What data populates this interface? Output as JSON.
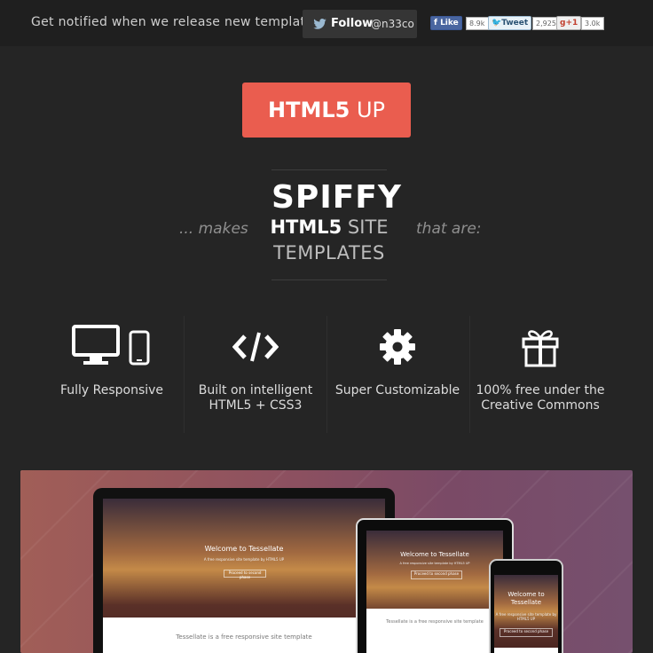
{
  "topbar": {
    "notify_text": "Get notified when we release new templates!",
    "follow_label": "Follow",
    "follow_handle": "@n33co",
    "like_label": "Like",
    "like_count": "8.9k",
    "tweet_label": "Tweet",
    "tweet_count": "2,925",
    "plusone_label": "+1",
    "plusone_count": "3.0k"
  },
  "logo": {
    "bold": "HTML5",
    "light": " UP"
  },
  "tagline": {
    "lead": "... makes",
    "title": "SPIFFY",
    "line2_bold": "HTML5",
    "line2_rest": " SITE",
    "line3": "TEMPLATES",
    "tail": "that are:"
  },
  "features": [
    {
      "icon": "devices-icon",
      "text": "Fully Responsive"
    },
    {
      "icon": "code-icon",
      "text": "Built on intelligent HTML5 + CSS3"
    },
    {
      "icon": "gear-icon",
      "text": "Super Customizable"
    },
    {
      "icon": "gift-icon",
      "text": "100% free under the Creative Commons"
    }
  ],
  "showcase": {
    "welcome": "Welcome to Tessellate",
    "welcome_phone": "Welcome to Tessellate",
    "subtitle": "A free responsive site template by HTML5 UP",
    "button": "Proceed to second phase",
    "footer_text": "Tessellate is a free responsive site template"
  },
  "colors": {
    "accent": "#ea5d4f",
    "background": "#252525",
    "topbar": "#1f1f1f"
  }
}
